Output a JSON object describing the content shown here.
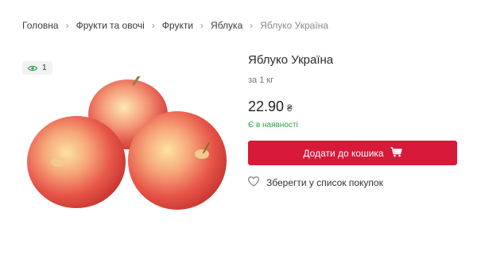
{
  "breadcrumb": {
    "items": [
      "Головна",
      "Фрукти та овочі",
      "Фрукти",
      "Яблука"
    ],
    "current": "Яблуко Україна",
    "separator": "›"
  },
  "product": {
    "views": "1",
    "title": "Яблуко Україна",
    "unit": "за 1 кг",
    "price": "22.90",
    "currency": "₴",
    "stock": "Є в наявності",
    "add_to_cart_label": "Додати до кошика",
    "save_label": "Зберегти у список покупок"
  },
  "colors": {
    "accent": "#d7193a",
    "in_stock": "#2e9e45",
    "views_icon": "#2e9e45"
  },
  "icons": {
    "views": "eye-icon",
    "cart": "cart-icon",
    "save": "heart-icon",
    "separator": "chevron-right-icon"
  }
}
